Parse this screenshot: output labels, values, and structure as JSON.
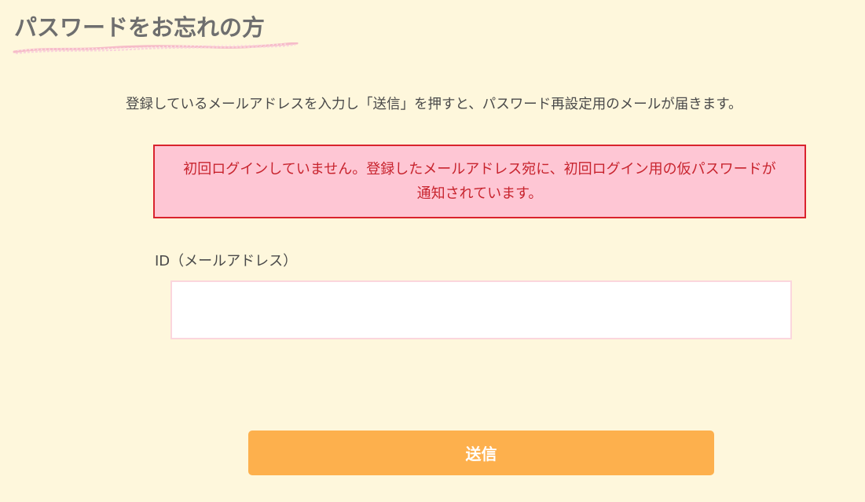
{
  "page": {
    "title": "パスワードをお忘れの方",
    "instruction": "登録しているメールアドレスを入力し「送信」を押すと、パスワード再設定用のメールが届きます。"
  },
  "alert": {
    "message": "初回ログインしていません。登録したメールアドレス宛に、初回ログイン用の仮パスワードが通知されています。"
  },
  "form": {
    "id_label": "ID（メールアドレス）",
    "id_value": "",
    "id_placeholder": "",
    "submit_label": "送信"
  },
  "colors": {
    "background": "#fef7dc",
    "alert_background": "#fec6d4",
    "alert_border": "#d9232d",
    "alert_text": "#c8242e",
    "button": "#fdb04d",
    "input_border": "#fbd6dd"
  }
}
